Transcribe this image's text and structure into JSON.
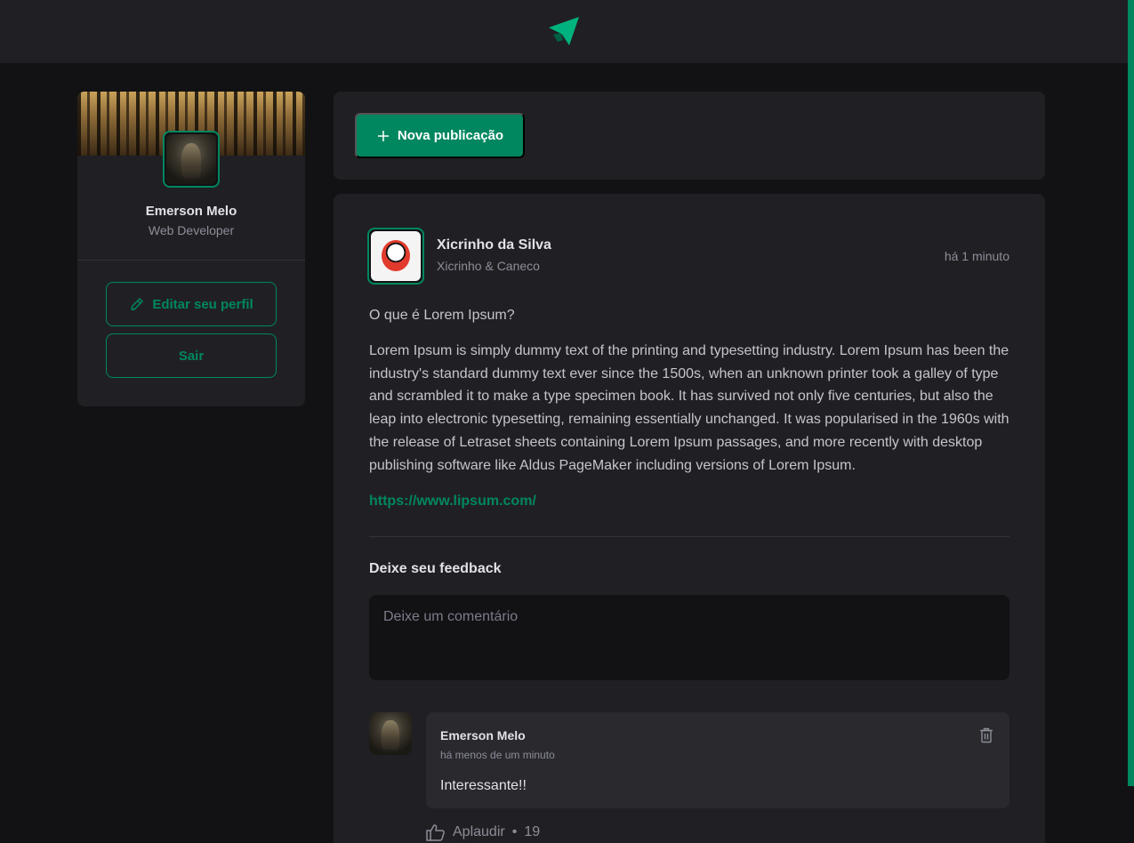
{
  "brand": {
    "logo": "paper-plane-logo",
    "accent": "#00875f"
  },
  "profile": {
    "name": "Emerson Melo",
    "role": "Web Developer",
    "edit_label": "Editar seu perfil",
    "exit_label": "Sair"
  },
  "new_post": {
    "label": "Nova publicação"
  },
  "post": {
    "author": {
      "name": "Xicrinho da Silva",
      "role": "Xicrinho & Caneco"
    },
    "time": "há 1 minuto",
    "title": "O que é Lorem Ipsum?",
    "body": "Lorem Ipsum is simply dummy text of the printing and typesetting industry. Lorem Ipsum has been the industry's standard dummy text ever since the 1500s, when an unknown printer took a galley of type and scrambled it to make a type specimen book. It has survived not only five centuries, but also the leap into electronic typesetting, remaining essentially unchanged. It was popularised in the 1960s with the release of Letraset sheets containing Lorem Ipsum passages, and more recently with desktop publishing software like Aldus PageMaker including versions of Lorem Ipsum.",
    "link": "https://www.lipsum.com/"
  },
  "feedback": {
    "title": "Deixe seu feedback",
    "placeholder": "Deixe um comentário"
  },
  "comment": {
    "author": "Emerson Melo",
    "time": "há menos de um minuto",
    "text": "Interessante!!",
    "applaud_label": "Aplaudir",
    "applaud_separator": "•",
    "applaud_count": "19"
  }
}
